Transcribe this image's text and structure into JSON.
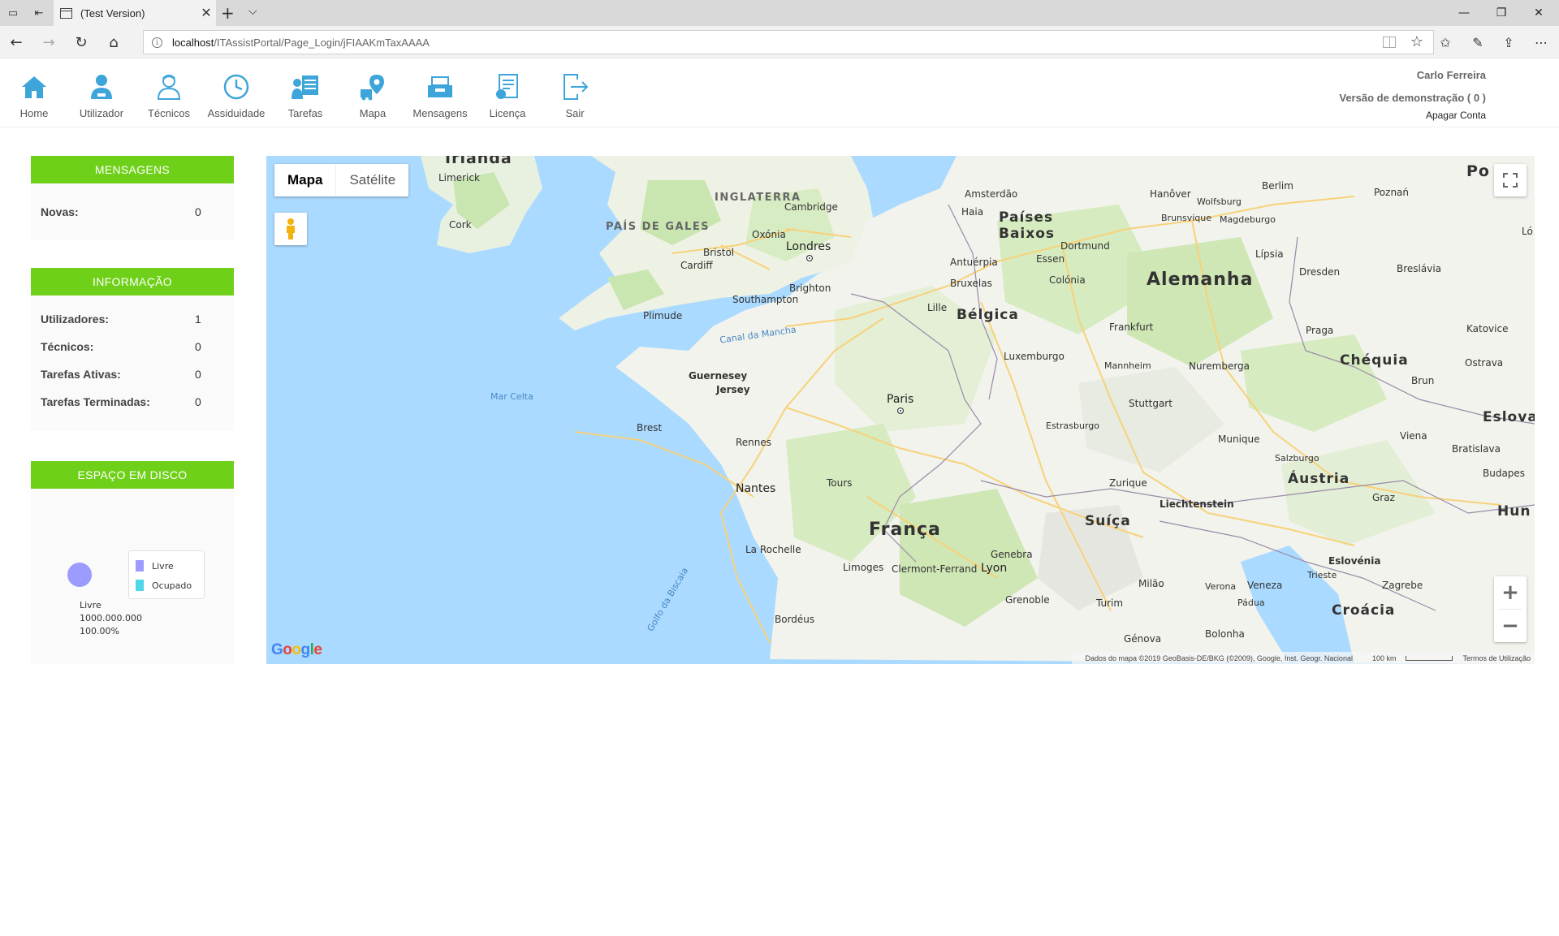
{
  "browser": {
    "tab_title": "(Test Version)",
    "url_host": "localhost",
    "url_path": "/ITAssistPortal/Page_Login/jFIAAKmTaxAAAA"
  },
  "nav": {
    "items": [
      {
        "label": "Home",
        "icon": "home-icon"
      },
      {
        "label": "Utilizador",
        "icon": "user-icon"
      },
      {
        "label": "Técnicos",
        "icon": "technician-icon"
      },
      {
        "label": "Assiduidade",
        "icon": "clock-icon"
      },
      {
        "label": "Tarefas",
        "icon": "tasks-icon"
      },
      {
        "label": "Mapa",
        "icon": "map-pin-icon"
      },
      {
        "label": "Mensagens",
        "icon": "inbox-icon"
      },
      {
        "label": "Licença",
        "icon": "license-icon"
      },
      {
        "label": "Sair",
        "icon": "logout-icon"
      }
    ]
  },
  "user": {
    "name": "Carlo Ferreira",
    "demo_version": "Versão de demonstração ( 0 )",
    "delete_account": "Apagar Conta"
  },
  "messages": {
    "title": "MENSAGENS",
    "rows": [
      {
        "label": "Novas:",
        "value": "0"
      }
    ]
  },
  "info": {
    "title": "INFORMAÇÃO",
    "rows": [
      {
        "label": "Utilizadores:",
        "value": "1"
      },
      {
        "label": "Técnicos:",
        "value": "0"
      },
      {
        "label": "Tarefas Ativas:",
        "value": "0"
      },
      {
        "label": "Tarefas Terminadas:",
        "value": "0"
      }
    ]
  },
  "disk": {
    "title": "ESPAÇO EM DISCO",
    "legend": [
      {
        "label": "Livre",
        "color": "#9c9cff"
      },
      {
        "label": "Ocupado",
        "color": "#4fd6e8"
      }
    ],
    "caption_label": "Livre",
    "caption_value": "1000.000.000",
    "caption_percent": "100.00%"
  },
  "map": {
    "type_map": "Mapa",
    "type_satellite": "Satélite",
    "zoom_in": "+",
    "zoom_out": "−",
    "attribution": "Dados do mapa ©2019 GeoBasis-DE/BKG (©2009), Google, Inst. Geogr. Nacional",
    "scale": "100 km",
    "terms": "Termos de Utilização",
    "logo": "Google",
    "labels": {
      "irlanda": "Irlanda",
      "limerick": "Limerick",
      "cork": "Cork",
      "inglaterra": "INGLATERRA",
      "pais_gales": "PAÍS DE GALES",
      "cambridge": "Cambridge",
      "oxonia": "Oxónia",
      "londres": "Londres",
      "bristol": "Bristol",
      "cardiff": "Cardiff",
      "brighton": "Brighton",
      "southampton": "Southampton",
      "plimude": "Plimude",
      "canal": "Canal da Mancha",
      "mar_celta": "Mar Celta",
      "guernesey": "Guernesey",
      "jersey": "Jersey",
      "brest": "Brest",
      "rennes": "Rennes",
      "nantes": "Nantes",
      "tours": "Tours",
      "paris": "Paris",
      "franca": "França",
      "la_rochelle": "La Rochelle",
      "limoges": "Limoges",
      "clermont": "Clermont-Ferrand",
      "lyon": "Lyon",
      "genebra": "Genebra",
      "grenoble": "Grenoble",
      "bordeus": "Bordéus",
      "golfo": "Golfo da Biscaia",
      "amsterdao": "Amsterdão",
      "haia": "Haia",
      "paises_baixos_1": "Países",
      "paises_baixos_2": "Baixos",
      "antuerpia": "Antuérpia",
      "bruxelas": "Bruxelas",
      "belgica": "Bélgica",
      "lille": "Lille",
      "dortmund": "Dortmund",
      "essen": "Essen",
      "colonia": "Colónia",
      "luxemburgo": "Luxemburgo",
      "frankfurt": "Frankfurt",
      "mannheim": "Mannheim",
      "estrasburgo": "Estrasburgo",
      "stuttgart": "Stuttgart",
      "nuremberga": "Nuremberga",
      "alemanha": "Alemanha",
      "hanover": "Hanôver",
      "wolfsburg": "Wolfsburg",
      "brunsvique": "Brunsvique",
      "magdeburgo": "Magdeburgo",
      "berlim": "Berlim",
      "lipsia": "Lípsia",
      "dresden": "Dresden",
      "poznan": "Poznań",
      "breslavia": "Breslávia",
      "polonia": "Po",
      "lodz": "Ló",
      "praga": "Praga",
      "chequia": "Chéquia",
      "katovice": "Katovice",
      "ostrava": "Ostrava",
      "brun": "Brun",
      "munique": "Munique",
      "salzburgo": "Salzburgo",
      "viena": "Viena",
      "bratislava": "Bratislava",
      "eslovaquia": "Eslova",
      "austria": "Áustria",
      "budapeste": "Budapes",
      "hungria": "Hun",
      "zurique": "Zurique",
      "liechtenstein": "Liechtenstein",
      "suica": "Suíça",
      "graz": "Graz",
      "eslovenia": "Eslovénia",
      "zagrebe": "Zagrebe",
      "trieste": "Trieste",
      "croacia": "Croácia",
      "turim": "Turim",
      "milao": "Milão",
      "verona": "Verona",
      "veneza": "Veneza",
      "padua": "Pádua",
      "genova": "Génova",
      "bolonha": "Bolonha"
    }
  }
}
